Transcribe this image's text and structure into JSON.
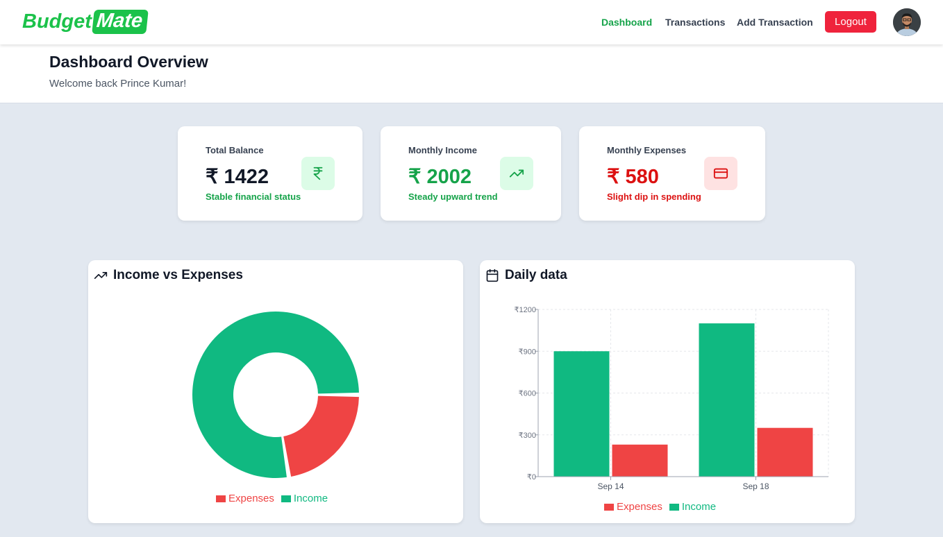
{
  "brand": {
    "part1": "Budget",
    "part2": "Mate"
  },
  "nav": {
    "dashboard": "Dashboard",
    "transactions": "Transactions",
    "add_transaction": "Add Transaction",
    "logout": "Logout"
  },
  "header": {
    "title": "Dashboard Overview",
    "subtitle": "Welcome back Prince Kumar!"
  },
  "cards": {
    "balance": {
      "label": "Total Balance",
      "value": "₹ 1422",
      "note": "Stable financial status"
    },
    "income": {
      "label": "Monthly Income",
      "value": "₹ 2002",
      "note": "Steady upward trend"
    },
    "expenses": {
      "label": "Monthly Expenses",
      "value": "₹ 580",
      "note": "Slight dip in spending"
    }
  },
  "panels": {
    "pie_title": "Income vs Expenses",
    "bar_title": "Daily data"
  },
  "colors": {
    "income": "#10b981",
    "expenses": "#ef4444",
    "brand": "#1bc24a",
    "logout": "#ef233c"
  },
  "chart_data": [
    {
      "type": "pie",
      "labels": [
        "Expenses",
        "Income"
      ],
      "values": [
        580,
        2002
      ],
      "legend": "bottom"
    },
    {
      "type": "bar",
      "categories": [
        "Sep 14",
        "Sep 18"
      ],
      "series": [
        {
          "name": "Income",
          "values": [
            900,
            1100
          ]
        },
        {
          "name": "Expenses",
          "values": [
            230,
            350
          ]
        }
      ],
      "ylim": [
        0,
        1200
      ],
      "yticks": [
        "₹0",
        "₹300",
        "₹600",
        "₹900",
        "₹1200"
      ],
      "legend_labels": [
        "Expenses",
        "Income"
      ],
      "legend": "bottom",
      "grid": true
    }
  ]
}
